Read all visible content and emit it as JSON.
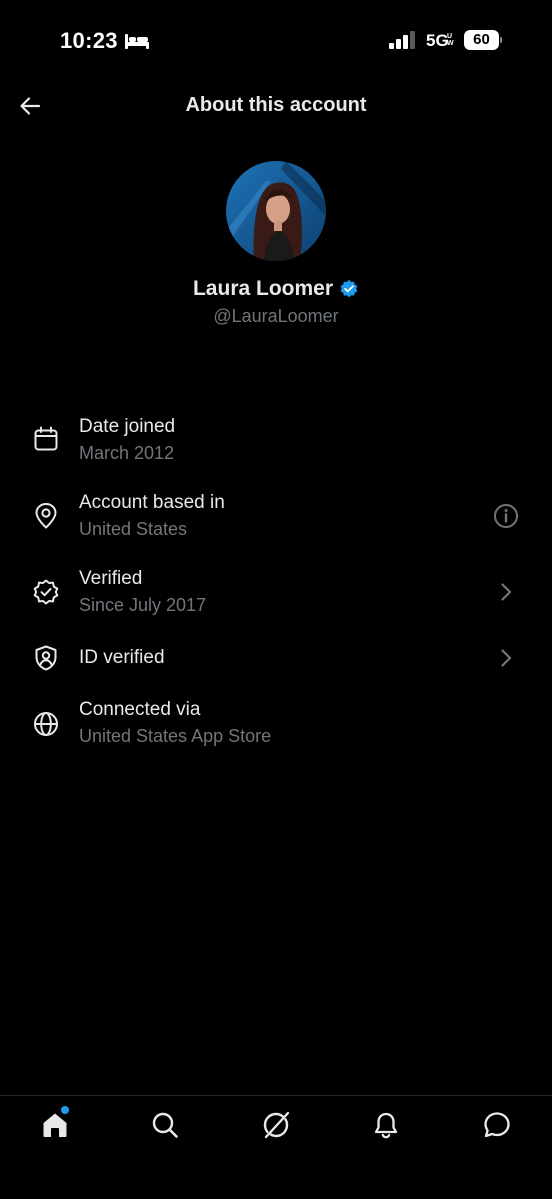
{
  "status_bar": {
    "time": "10:23",
    "network": "5G",
    "network_sub": "UW",
    "battery": "60"
  },
  "header": {
    "title": "About this account"
  },
  "profile": {
    "name": "Laura Loomer",
    "handle": "@LauraLoomer",
    "verified": true
  },
  "rows": [
    {
      "icon": "calendar-icon",
      "title": "Date joined",
      "subtitle": "March 2012",
      "trailing": ""
    },
    {
      "icon": "location-pin-icon",
      "title": "Account based in",
      "subtitle": "United States",
      "trailing": "info-icon"
    },
    {
      "icon": "verified-badge-icon",
      "title": "Verified",
      "subtitle": "Since July 2017",
      "trailing": "chevron-right-icon"
    },
    {
      "icon": "id-shield-icon",
      "title": "ID verified",
      "subtitle": "",
      "trailing": "chevron-right-icon"
    },
    {
      "icon": "globe-icon",
      "title": "Connected via",
      "subtitle": "United States App Store",
      "trailing": ""
    }
  ],
  "nav": {
    "items": [
      "home-icon",
      "search-icon",
      "grok-icon",
      "notifications-icon",
      "messages-icon"
    ],
    "active": "home-icon"
  },
  "colors": {
    "background": "#000000",
    "primary_text": "#e7e9ea",
    "secondary_text": "#71767b",
    "accent": "#1d9bf0"
  }
}
